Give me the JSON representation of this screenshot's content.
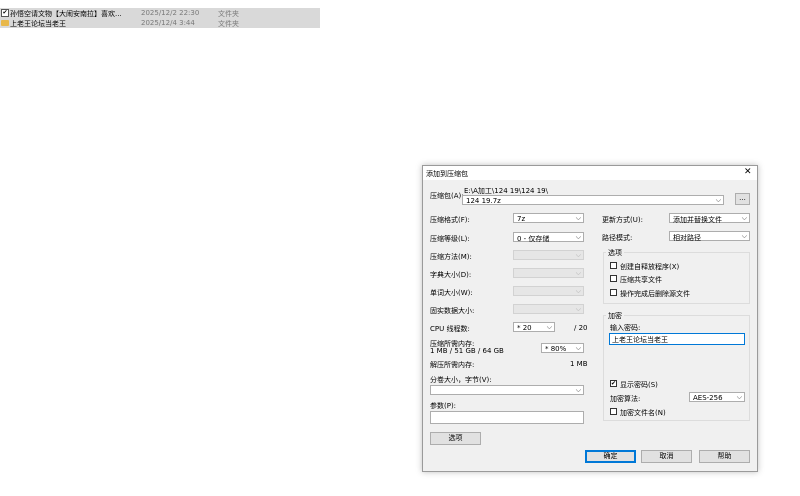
{
  "files": [
    {
      "check": "✔",
      "name": "孙悟空请文物【大闹安南拉】喜欢...",
      "date": "2025/12/2 22:30",
      "type": "文件夹"
    },
    {
      "check": "",
      "name": "上老王论坛当老王",
      "date": "2025/12/4 3:44",
      "type": "文件夹"
    }
  ],
  "dialog": {
    "title": "添加到压缩包",
    "close": "✕",
    "archive_label": "压缩包(A):",
    "archive_path": "E:\\A加工\\124 19\\124 19\\",
    "archive_name": "124 19.7z",
    "browse": "...",
    "format_label": "压缩格式(F):",
    "format_value": "7z",
    "level_label": "压缩等级(L):",
    "level_value": "0 - 仅存储",
    "method_label": "压缩方法(M):",
    "dict_label": "字典大小(D):",
    "word_label": "单词大小(W):",
    "solid_label": "固实数据大小:",
    "cpu_label": "CPU 线程数:",
    "cpu_value": "* 20",
    "cpu_total": "/ 20",
    "mem_label": "压缩所需内存:",
    "mem_sub": "1 MB / 51 GB / 64 GB",
    "mem_value": "* 80%",
    "decomp_label": "解压所需内存:",
    "decomp_value": "1 MB",
    "split_label": "分卷大小，字节(V):",
    "params_label": "参数(P):",
    "options_btn": "选项",
    "update_label": "更新方式(U):",
    "update_value": "添加并替换文件",
    "pathmode_label": "路径模式:",
    "pathmode_value": "相对路径",
    "options_group": "选项",
    "opt_sfx": "创建自释放程序(X)",
    "opt_shared": "压缩共享文件",
    "opt_delete": "操作完成后删除源文件",
    "enc_group": "加密",
    "pwd_label": "输入密码:",
    "pwd_value": "上老王论坛当老王",
    "show_pwd": "显示密码(S)",
    "show_pwd_check": "✔",
    "enc_method_label": "加密算法:",
    "enc_method_value": "AES-256",
    "enc_names": "加密文件名(N)",
    "ok": "确定",
    "cancel": "取消",
    "help": "帮助"
  }
}
